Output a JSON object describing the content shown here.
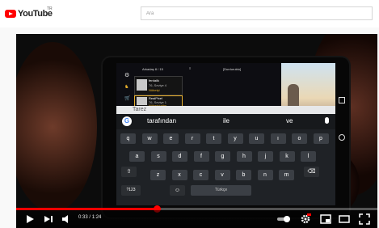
{
  "masthead": {
    "logo_text": "YouTube",
    "country_code": "TR",
    "search_placeholder": "Ara"
  },
  "video": {
    "phone_ui": {
      "friends_header": "Arkadaş 8 / 15",
      "title_label": "[Durduruldu]",
      "friends": [
        {
          "name": "ferdailk",
          "line1": "76, Seviye 4",
          "line2": "Nöbetçi"
        },
        {
          "name": "RealPixel",
          "line1": "76, Seviye 1",
          "line2": "Nöbetçiydim"
        }
      ],
      "compose_placeholder": "Tarez",
      "suggestions": [
        "tarafından",
        "ile",
        "ve"
      ],
      "keyboard_rows": [
        [
          "q",
          "w",
          "e",
          "r",
          "t",
          "y",
          "u",
          "ı",
          "o",
          "p"
        ],
        [
          "a",
          "s",
          "d",
          "f",
          "g",
          "h",
          "j",
          "k",
          "l"
        ],
        [
          "z",
          "x",
          "c",
          "v",
          "b",
          "n",
          "m"
        ]
      ],
      "number_key": "?123",
      "space_label": "Türkçe"
    },
    "player": {
      "time_current": "0:33",
      "time_separator": "/",
      "time_total": "1:24",
      "progress_fraction": 0.39,
      "accent_color": "#ff0000"
    }
  }
}
